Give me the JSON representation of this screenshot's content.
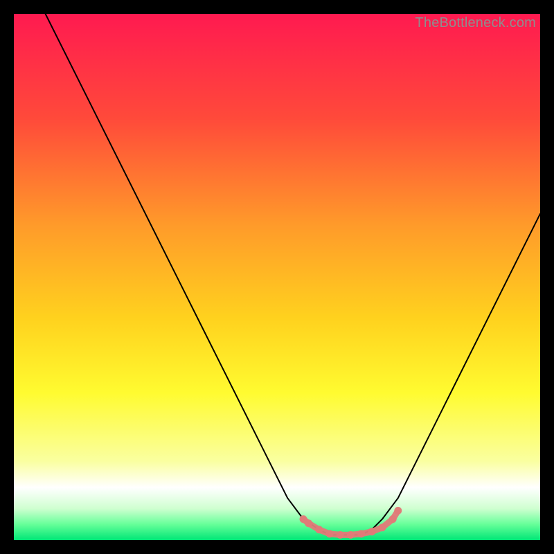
{
  "watermark": "TheBottleneck.com",
  "chart_data": {
    "type": "line",
    "title": "",
    "xlabel": "",
    "ylabel": "",
    "xlim": [
      0,
      100
    ],
    "ylim": [
      0,
      100
    ],
    "grid": false,
    "legend": false,
    "background_gradient": {
      "stops": [
        {
          "offset": 0.0,
          "color": "#ff1a50"
        },
        {
          "offset": 0.2,
          "color": "#ff4a3a"
        },
        {
          "offset": 0.4,
          "color": "#ff9a2a"
        },
        {
          "offset": 0.58,
          "color": "#ffd21e"
        },
        {
          "offset": 0.72,
          "color": "#fffb30"
        },
        {
          "offset": 0.85,
          "color": "#faffa0"
        },
        {
          "offset": 0.9,
          "color": "#ffffff"
        },
        {
          "offset": 0.94,
          "color": "#cfffd0"
        },
        {
          "offset": 0.97,
          "color": "#66ff99"
        },
        {
          "offset": 1.0,
          "color": "#00e676"
        }
      ]
    },
    "series": [
      {
        "name": "bottleneck-curve",
        "stroke": "#000000",
        "stroke_width": 2,
        "x": [
          6,
          12,
          18,
          24,
          30,
          36,
          42,
          48,
          52,
          55,
          58,
          60,
          62,
          64,
          66,
          68,
          70,
          73,
          78,
          84,
          90,
          96,
          100
        ],
        "y": [
          100,
          88,
          76,
          64,
          52,
          40,
          28,
          16,
          8,
          4,
          2,
          1,
          1,
          1,
          1,
          2,
          4,
          8,
          18,
          30,
          42,
          54,
          62
        ]
      }
    ],
    "highlight": {
      "name": "ideal-range-marker",
      "stroke": "#e07a78",
      "stroke_width": 9,
      "points": [
        {
          "x": 55,
          "y": 4.0
        },
        {
          "x": 56,
          "y": 3.2
        },
        {
          "x": 58,
          "y": 2.0
        },
        {
          "x": 60,
          "y": 1.2
        },
        {
          "x": 62,
          "y": 1.0
        },
        {
          "x": 64,
          "y": 1.0
        },
        {
          "x": 66,
          "y": 1.2
        },
        {
          "x": 68,
          "y": 1.6
        },
        {
          "x": 70,
          "y": 2.4
        },
        {
          "x": 72,
          "y": 4.0
        },
        {
          "x": 73,
          "y": 5.6
        }
      ]
    }
  }
}
